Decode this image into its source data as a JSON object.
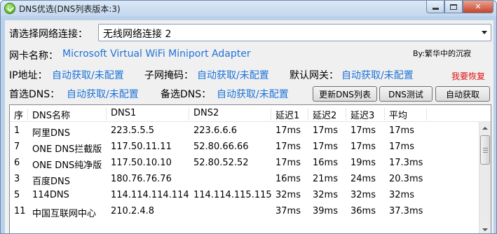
{
  "window": {
    "title": "DNS优选(DNS列表版本:3)",
    "icon": "app-icon"
  },
  "connection": {
    "label": "请选择网络连接：",
    "selected": "无线网络连接 2"
  },
  "adapter": {
    "label": "网卡名称：",
    "value": "Microsoft Virtual WiFi Miniport Adapter"
  },
  "author": "By:繁华中的沉寂",
  "ip": {
    "ip_label": "IP地址：",
    "ip_value": "自动获取/未配置",
    "mask_label": "子网掩码：",
    "mask_value": "自动获取/未配置",
    "gw_label": "默认网关：",
    "gw_value": "自动获取/未配置",
    "restore_label": "我要恢复"
  },
  "dns_config": {
    "primary_label": "首选DNS：",
    "primary_value": "自动获取/未配置",
    "secondary_label": "备选DNS：",
    "secondary_value": "自动获取/未配置"
  },
  "buttons": {
    "update_list": "更新DNS列表",
    "test_dns": "DNS测试",
    "auto_get": "自动获取"
  },
  "colors": {
    "link_blue": "#1e73d8",
    "restore_red": "#e01010"
  },
  "table": {
    "columns": [
      "序",
      "DNS名称",
      "DNS1",
      "DNS2",
      "延迟1",
      "延迟2",
      "延迟3",
      "平均"
    ],
    "rows": [
      [
        "1",
        "阿里DNS",
        "223.5.5.5",
        "223.6.6.6",
        "17ms",
        "17ms",
        "17ms",
        "17ms"
      ],
      [
        "7",
        "ONE DNS拦截版",
        "117.50.11.11",
        "52.80.66.66",
        "17ms",
        "17ms",
        "17ms",
        "17ms"
      ],
      [
        "6",
        "ONE DNS纯净版",
        "117.50.10.10",
        "52.80.52.52",
        "17ms",
        "16ms",
        "19ms",
        "17.3ms"
      ],
      [
        "3",
        "百度DNS",
        "180.76.76.76",
        "",
        "16ms",
        "21ms",
        "24ms",
        "20.3ms"
      ],
      [
        "5",
        "114DNS",
        "114.114.114.114",
        "114.114.115.115",
        "32ms",
        "32ms",
        "32ms",
        "32ms"
      ],
      [
        "11",
        "中国互联网中心",
        "210.2.4.8",
        "",
        "37ms",
        "39ms",
        "36ms",
        "37.3ms"
      ]
    ]
  }
}
